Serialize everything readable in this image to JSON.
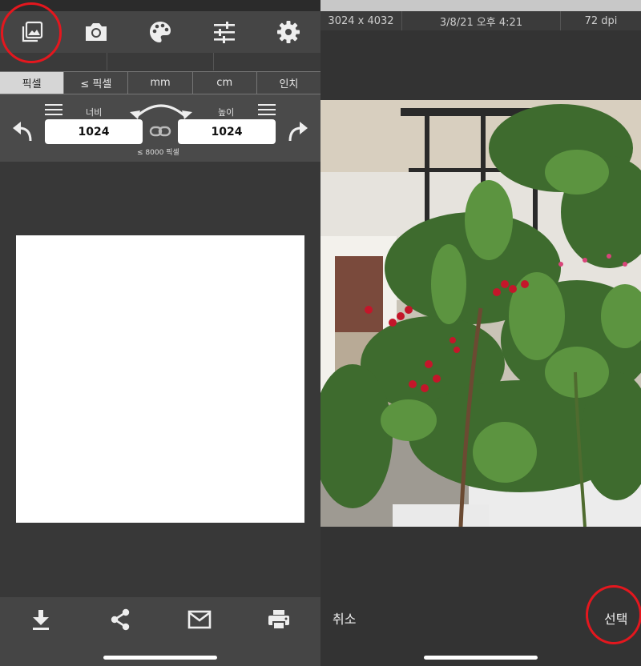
{
  "left": {
    "toolbar": {
      "icons": [
        "gallery-icon",
        "camera-icon",
        "palette-icon",
        "sliders-icon",
        "gear-icon"
      ]
    },
    "units": [
      "픽셀",
      "≤ 픽셀",
      "mm",
      "cm",
      "인치"
    ],
    "active_unit": "픽셀",
    "width_label": "너비",
    "height_label": "높이",
    "width_value": "1024",
    "height_value": "1024",
    "max_note": "≤ 8000 픽셀",
    "bottom_icons": [
      "download-icon",
      "share-icon",
      "mail-icon",
      "print-icon"
    ]
  },
  "right": {
    "info": {
      "dimensions": "3024 x 4032",
      "datetime": "3/8/21 오후 4:21",
      "dpi": "72 dpi"
    },
    "cancel_label": "취소",
    "select_label": "선택"
  },
  "colors": {
    "highlight": "#e4171e"
  }
}
